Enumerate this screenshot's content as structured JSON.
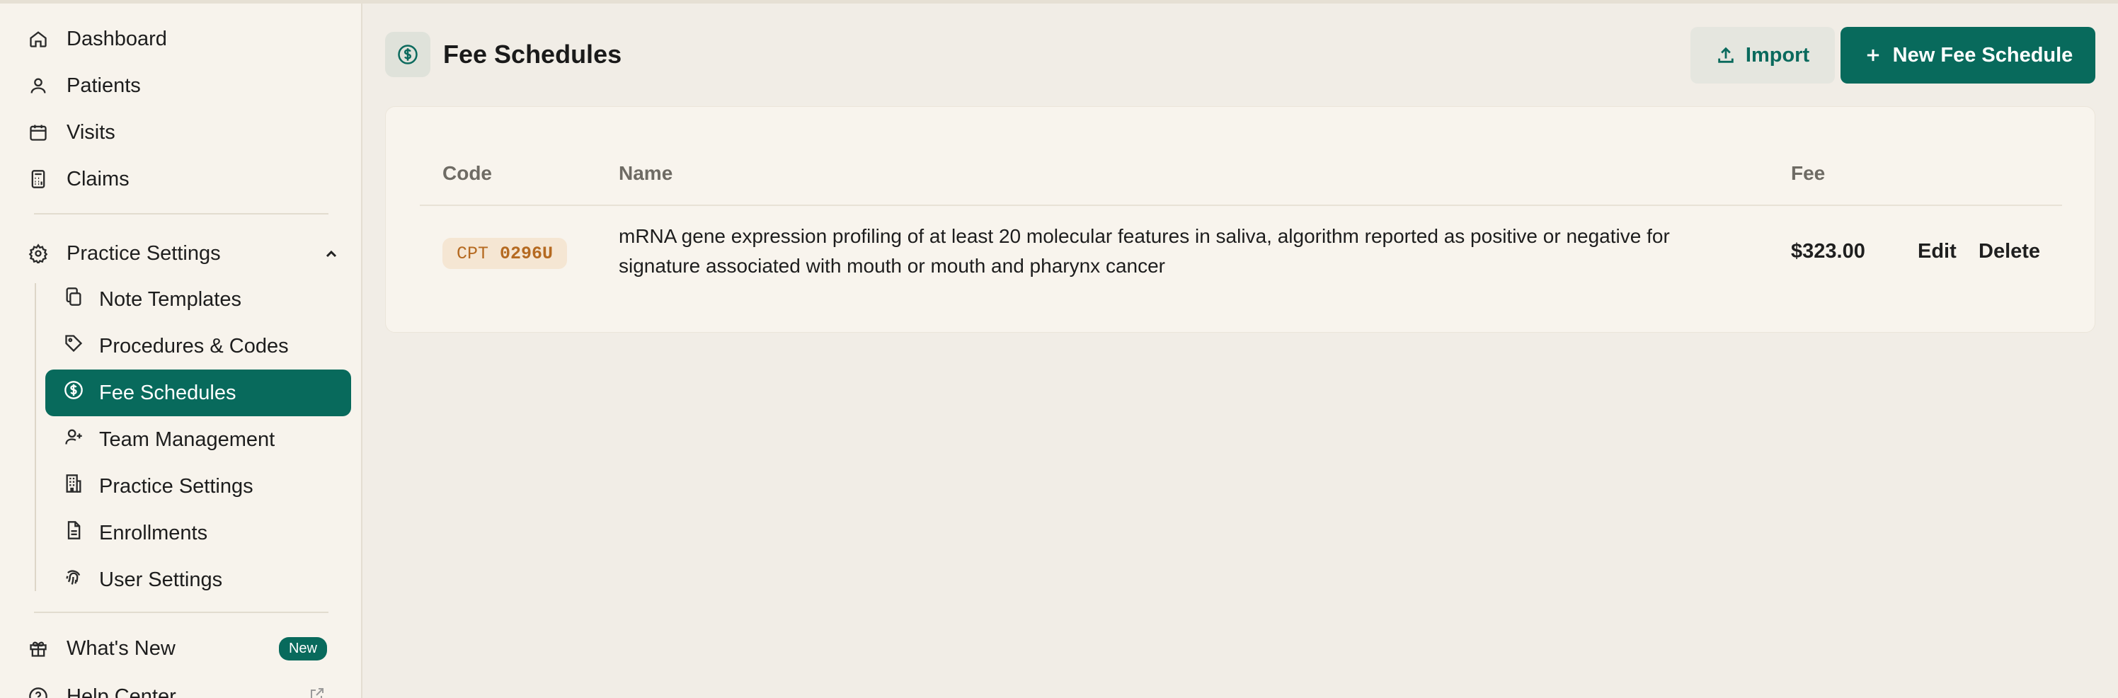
{
  "sidebar": {
    "nav": [
      {
        "label": "Dashboard",
        "icon": "home-icon"
      },
      {
        "label": "Patients",
        "icon": "user-icon"
      },
      {
        "label": "Visits",
        "icon": "calendar-icon"
      },
      {
        "label": "Claims",
        "icon": "calculator-icon"
      }
    ],
    "section": {
      "label": "Practice Settings",
      "icon": "gear-icon"
    },
    "sub_items": [
      {
        "label": "Note Templates",
        "icon": "copy-icon"
      },
      {
        "label": "Procedures & Codes",
        "icon": "tag-icon"
      },
      {
        "label": "Fee Schedules",
        "icon": "dollar-circle-icon",
        "active": true
      },
      {
        "label": "Team Management",
        "icon": "user-plus-icon"
      },
      {
        "label": "Practice Settings",
        "icon": "building-icon"
      },
      {
        "label": "Enrollments",
        "icon": "document-icon"
      },
      {
        "label": "User Settings",
        "icon": "fingerprint-icon"
      }
    ],
    "whats_new": {
      "label": "What's New",
      "badge": "New",
      "icon": "gift-icon"
    },
    "help": {
      "label": "Help Center",
      "icon": "help-icon"
    }
  },
  "header": {
    "title": "Fee Schedules"
  },
  "actions": {
    "import_label": "Import",
    "new_label": "New Fee Schedule"
  },
  "table": {
    "columns": {
      "code": "Code",
      "name": "Name",
      "fee": "Fee"
    },
    "rows": [
      {
        "code_type": "CPT",
        "code": "0296U",
        "name_line1": "mRNA gene expression profiling of at least 20 molecular features in saliva, algorithm reported as positive or negative for",
        "name_line2": "signature associated with mouth or mouth and pharynx cancer",
        "fee": "$323.00",
        "edit_label": "Edit",
        "delete_label": "Delete"
      }
    ]
  },
  "colors": {
    "accent": "#086a5c",
    "background": "#f1ede6",
    "sidebar": "#f7f3ec",
    "code_badge": "#f5e6d3"
  }
}
